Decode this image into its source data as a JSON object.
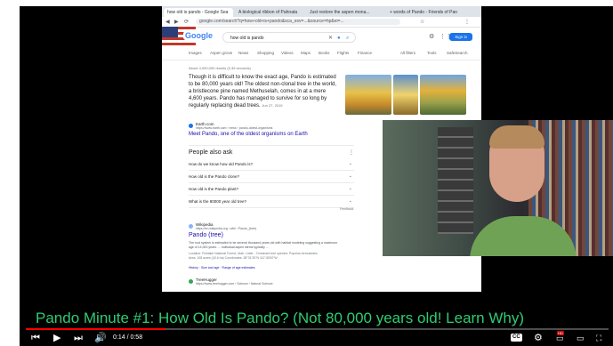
{
  "browser": {
    "tabs": [
      {
        "label": "how old is pando - Google Sea"
      },
      {
        "label": "A biological ribbon of Pahnata"
      },
      {
        "label": "Just restore the aspen mona..."
      },
      {
        "label": "+ words of Pando - Friends of Pan"
      }
    ],
    "address": "google.com/search?q=how+old+is+pando&sca_esv=...&source=hp&ei=...",
    "search_query": "how old is pando",
    "sign_in": "Sign in",
    "logo": "Google",
    "filters": [
      "Images",
      "Aspen grove",
      "News",
      "Shopping",
      "Videos",
      "Maps",
      "Books",
      "Flights",
      "Finance",
      "All filters",
      "Tools",
      "SafeSearch"
    ],
    "stats": "About 4,090,000 results (0.35 seconds)",
    "snippet": "Though it is difficult to know the exact age, Pando is estimated to be 80,000 years old! The oldest non-clonal tree in the world, a bristlecone pine named Methuselah, comes in at a mere 4,600 years. Pando has managed to survive for so long by regularly replacing dead trees.",
    "snippet_date": "Jun 27, 2019",
    "source_name": "Earth.com",
    "source_url": "https://www.earth.com › news › pando-oldest-organisms",
    "source_link": "Meet Pando, one of the oldest organisms on Earth",
    "paa_title": "People also ask",
    "paa_questions": [
      "How do we know how old Pando is?",
      "How old is the Pando clone?",
      "How old is the Pando plant?",
      "What is the 80000 year old tree?"
    ],
    "feedback": "Feedback",
    "result2": {
      "name": "Wikipedia",
      "url": "https://en.wikipedia.org › wiki › Pando_(tree)",
      "title": "Pando (tree)",
      "text": "The root system is estimated to be several thousand years old with habitat modeling suggesting a maximum age of 14,000 years. ... Individual aspen stems typically ...",
      "meta1": "Location: Fishlake National Forest, Utah, Unite...   Dominant tree species: Populus tremuloides",
      "meta2": "Area: 108 acres (43.6 ha)   Coordinates: 38°31'30\"N 111°45'00\"W",
      "links": "History · Size and age · Range of age estimates"
    },
    "result3": {
      "name": "TreeHugger",
      "url": "https://www.treehugger.com › Science › Natural Science"
    }
  },
  "video": {
    "caption": "Pando Minute #1: How Old Is Pando? (Not 80,000 years old! Learn Why)",
    "time": "0:14 / 0:58",
    "progress": 0.24,
    "hd": "HD",
    "cc": "CC"
  }
}
